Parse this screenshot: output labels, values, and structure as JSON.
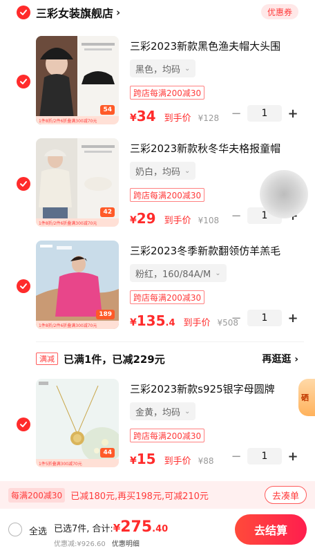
{
  "store": {
    "name": "三彩女装旗舰店",
    "arrow": "›",
    "coupon_label": "优惠券"
  },
  "items": [
    {
      "title": "三彩2023新款黑色渔夫帽大头围",
      "sku": "黑色，均码",
      "promo": "跨店每满200减30",
      "price_yen": "¥",
      "price_int": "34",
      "price_dec": "",
      "price_label": "到手价",
      "orig_price": "¥128",
      "qty": "1",
      "thumb_tag": "54",
      "thumb_promo": "1件8折/2件6折叠满300减70元"
    },
    {
      "title": "三彩2023新款秋冬华夫格报童帽",
      "sku": "奶白，均码",
      "promo": "跨店每满200减30",
      "price_yen": "¥",
      "price_int": "29",
      "price_dec": "",
      "price_label": "到手价",
      "orig_price": "¥108",
      "qty": "1",
      "thumb_tag": "42",
      "thumb_promo": "1件8折/2件6折叠满300减70元"
    },
    {
      "title": "三彩2023冬季新款翻领仿羊羔毛",
      "sku": "粉红，160/84A/M",
      "promo": "跨店每满200减30",
      "price_yen": "¥",
      "price_int": "135",
      "price_dec": ".4",
      "price_label": "到手价",
      "orig_price": "¥508",
      "qty": "1",
      "thumb_tag": "189",
      "thumb_promo": "1件8折/2件6折叠满300减70元"
    },
    {
      "title": "三彩2023新款s925银字母圆牌",
      "sku": "金黄，均码",
      "promo": "跨店每满200减30",
      "price_yen": "¥",
      "price_int": "15",
      "price_dec": "",
      "price_label": "到手价",
      "orig_price": "¥88",
      "qty": "1",
      "thumb_tag": "44",
      "thumb_promo": "1件5折叠满300减70元"
    }
  ],
  "group": {
    "tag": "满减",
    "text": "已满1件，已减229元",
    "link": "再逛逛 ›"
  },
  "side_badge": "硒",
  "promo_bar": {
    "tag": "每满200减30",
    "text": "已减180元,再买198元,可减210元",
    "button": "去凑单"
  },
  "checkout": {
    "select_all": "全选",
    "selected_count": "已选7件,",
    "total_label": "合计:",
    "total_yen": "¥",
    "total_int": "275",
    "total_dec": ".40",
    "discount": "优惠减:¥926.60",
    "detail": "优惠明细",
    "button": "去结算"
  },
  "colors": {
    "accent": "#ff2b2b",
    "promo_bg": "#fff0f0"
  }
}
